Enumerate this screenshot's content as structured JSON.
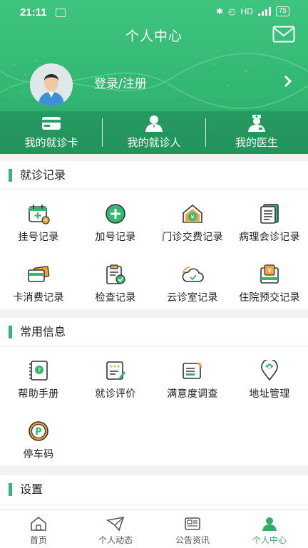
{
  "status_bar": {
    "time": "21:11",
    "network": "HD",
    "battery": "75"
  },
  "header": {
    "title": "个人中心",
    "login_label": "登录/注册"
  },
  "quick_links": [
    {
      "label": "我的就诊卡",
      "icon": "card-icon"
    },
    {
      "label": "我的就诊人",
      "icon": "person-icon"
    },
    {
      "label": "我的医生",
      "icon": "doctor-icon"
    }
  ],
  "sections": {
    "records": {
      "title": "就诊记录",
      "items": [
        {
          "label": "挂号记录",
          "icon": "calendar-plus-icon"
        },
        {
          "label": "加号记录",
          "icon": "plus-circle-icon"
        },
        {
          "label": "门诊交费记录",
          "icon": "yuan-house-icon"
        },
        {
          "label": "病理会诊记录",
          "icon": "report-icon"
        },
        {
          "label": "卡消费记录",
          "icon": "cards-icon"
        },
        {
          "label": "检查记录",
          "icon": "clipboard-check-icon"
        },
        {
          "label": "云诊室记录",
          "icon": "cloud-icon"
        },
        {
          "label": "住院预交记录",
          "icon": "yuan-doc-icon"
        }
      ]
    },
    "common": {
      "title": "常用信息",
      "items": [
        {
          "label": "帮助手册",
          "icon": "help-book-icon"
        },
        {
          "label": "就诊评价",
          "icon": "rating-icon"
        },
        {
          "label": "满意度调查",
          "icon": "survey-icon"
        },
        {
          "label": "地址管理",
          "icon": "location-icon"
        },
        {
          "label": "停车码",
          "icon": "parking-icon"
        }
      ]
    },
    "settings": {
      "title": "设置"
    }
  },
  "tabbar": [
    {
      "label": "首页",
      "icon": "home-icon",
      "active": false
    },
    {
      "label": "个人动态",
      "icon": "mail-send-icon",
      "active": false
    },
    {
      "label": "公告资讯",
      "icon": "news-icon",
      "active": false
    },
    {
      "label": "个人中心",
      "icon": "user-icon",
      "active": true
    }
  ],
  "colors": {
    "brand_green": "#33b873",
    "accent_orange": "#f2a33a",
    "active_tab": "#2fae6a"
  }
}
